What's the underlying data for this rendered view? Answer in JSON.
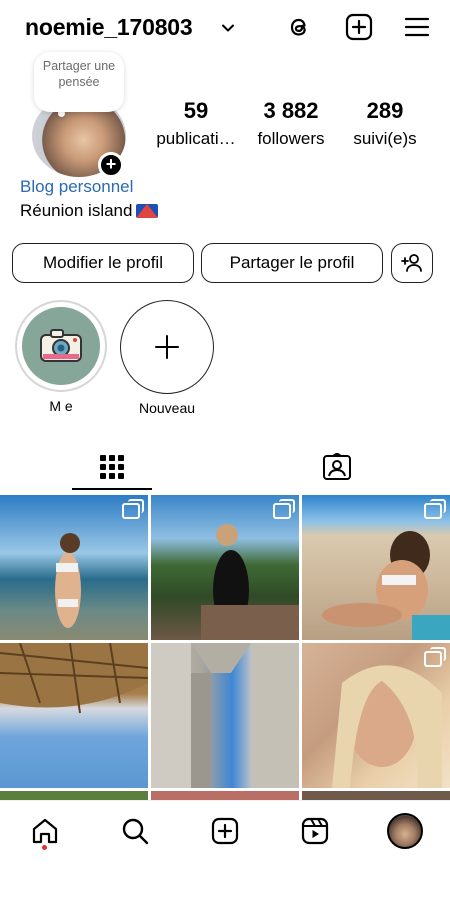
{
  "header": {
    "username": "noemie_170803",
    "icons": [
      "threads-icon",
      "add-post-icon",
      "menu-icon"
    ]
  },
  "profile": {
    "note": "Partager une pensée",
    "stats": [
      {
        "num": "59",
        "label": "publicati…"
      },
      {
        "num": "3 882",
        "label": "followers"
      },
      {
        "num": "289",
        "label": "suivi(e)s"
      }
    ],
    "bio_link": "Blog personnel",
    "bio_location": "Réunion island"
  },
  "buttons": {
    "edit": "Modifier le profil",
    "share": "Partager le profil"
  },
  "highlights": [
    {
      "label": "M e"
    },
    {
      "label": "Nouveau"
    }
  ],
  "tabs": [
    "grid-icon",
    "tagged-icon"
  ],
  "grid": {
    "tiles": [
      {
        "multi": true
      },
      {
        "multi": true
      },
      {
        "multi": true
      },
      {
        "multi": false
      },
      {
        "multi": false
      },
      {
        "multi": true
      }
    ]
  },
  "bottom_nav": [
    "home-icon",
    "search-icon",
    "create-icon",
    "reels-icon",
    "profile-avatar"
  ],
  "colors": {
    "link": "#2b6ab2",
    "notification_dot": "#e0312f"
  }
}
